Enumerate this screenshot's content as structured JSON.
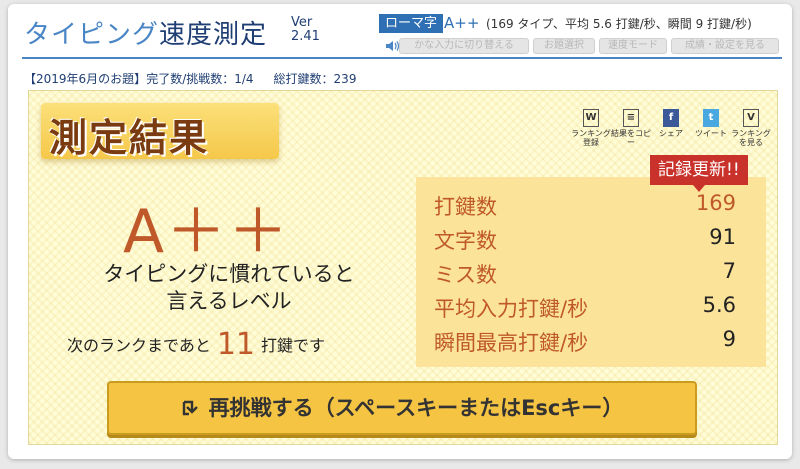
{
  "header": {
    "title_main": "タイピング",
    "title_sub": "速度測定",
    "version_label": "Ver",
    "version_number": "2.41",
    "mode_badge": "ローマ字",
    "summary_rank": "A++",
    "summary_detail": "(169 タイプ、平均 5.6 打鍵/秒、瞬間 9 打鍵/秒)",
    "buttons": [
      "かな入力に切り替える",
      "お題選択",
      "速度モード",
      "成績・設定を見る"
    ]
  },
  "info": {
    "topic": "【2019年6月のお題】",
    "progress": "完了数/挑戦数：1/4",
    "total": "総打鍵数：239"
  },
  "result": {
    "banner": "測定結果",
    "share": [
      {
        "icon": "W",
        "label": "ランキング登録"
      },
      {
        "icon": "≡",
        "label": "結果をコピー"
      },
      {
        "icon": "f",
        "label": "シェア"
      },
      {
        "icon": "t",
        "label": "ツイート"
      },
      {
        "icon": "V",
        "label": "ランキングを見る"
      }
    ],
    "rank": "A＋＋",
    "rank_desc_line1": "タイピングに慣れていると",
    "rank_desc_line2": "言えるレベル",
    "next_prefix": "次のランクまであと",
    "next_number": "11",
    "next_suffix": "打鍵です",
    "record_badge": "記録更新!!",
    "stats": [
      {
        "label": "打鍵数",
        "value": "169"
      },
      {
        "label": "文字数",
        "value": "91"
      },
      {
        "label": "ミス数",
        "value": "7"
      },
      {
        "label": "平均入力打鍵/秒",
        "value": "5.6"
      },
      {
        "label": "瞬間最高打鍵/秒",
        "value": "9"
      }
    ],
    "retry_label": "再挑戦する（スペースキーまたはEscキー）"
  },
  "colors": {
    "accent_blue": "#4a86c5",
    "rank_orange": "#c0592a",
    "record_red": "#c8322b",
    "button_gold": "#f5c443"
  }
}
